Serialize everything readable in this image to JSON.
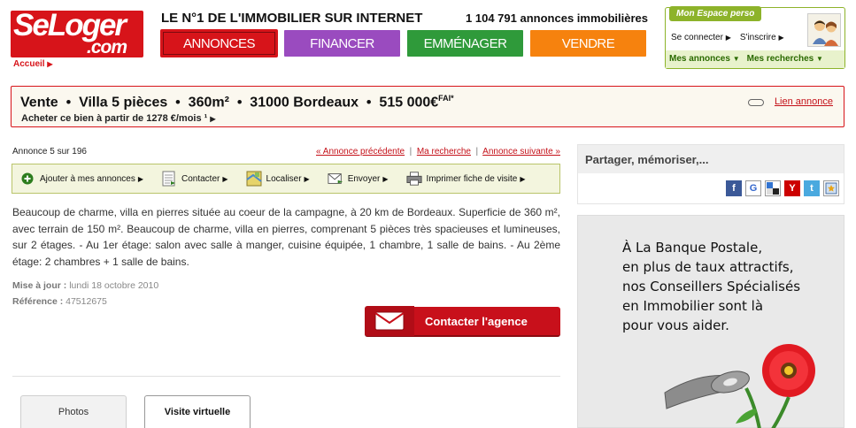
{
  "logo": {
    "line1": "SeLoger",
    "line2": ".com",
    "accueil": "Accueil"
  },
  "header": {
    "tagline": "LE N°1 DE L'IMMOBILIER SUR INTERNET",
    "count": "1 104 791",
    "count_label": "annonces immobilières"
  },
  "nav": [
    "ANNONCES",
    "FINANCER",
    "EMMÉNAGER",
    "VENDRE"
  ],
  "perso": {
    "tab": "Mon Espace perso",
    "connect": "Se connecter",
    "inscrire": "S'inscrire",
    "mes_annonces": "Mes annonces",
    "mes_recherches": "Mes recherches"
  },
  "listing": {
    "title": "Vente  •  Villa 5 pièces  •  360m²  •  31000 Bordeaux  •  515 000€",
    "fai": "FAI*",
    "subtitle": "Acheter ce bien à partir de 1278 €/mois ¹",
    "lien": "Lien annonce"
  },
  "annonce": {
    "number": "Annonce 5 sur 196",
    "prev": "« Annonce précédente",
    "search": "Ma recherche",
    "next": "Annonce suivante »",
    "sep": "|"
  },
  "toolbar": {
    "ajouter": "Ajouter à mes annonces",
    "contacter": "Contacter",
    "localiser": "Localiser",
    "envoyer": "Envoyer",
    "imprimer": "Imprimer fiche de visite"
  },
  "description": "Beaucoup de charme, villa en pierres située au coeur de la campagne, à 20 km de Bordeaux. Superficie de 360 m², avec terrain de 150 m². Beaucoup de charme, villa en pierres, comprenant 5 pièces très spacieuses et lumineuses, sur 2 étages. - Au 1er étage: salon avec salle à manger, cuisine équipée, 1 chambre, 1 salle de bains. - Au 2ème étage: 2 chambres + 1 salle de bains.",
  "meta": {
    "maj_label": "Mise à jour :",
    "maj_value": "lundi 18 octobre 2010",
    "ref_label": "Référence :",
    "ref_value": "47512675"
  },
  "contact_button": "Contacter l'agence",
  "tabs": [
    "Photos",
    "Visite virtuelle"
  ],
  "share": {
    "title": "Partager, mémoriser,...",
    "icons": [
      "facebook-icon",
      "google-icon",
      "delicious-icon",
      "yahoo-icon",
      "twitter-icon",
      "favorites-icon"
    ]
  },
  "ad": {
    "lines": [
      "À La Banque Postale,",
      "en plus de taux attractifs,",
      "nos Conseillers Spécialisés",
      "en Immobilier sont là",
      "pour vous aider."
    ]
  },
  "colors": {
    "brand_red": "#d7141a",
    "financer": "#9a4bbf",
    "emmenager": "#2f9a3a",
    "vendre": "#f6820e",
    "perso_green": "#8db32a"
  }
}
